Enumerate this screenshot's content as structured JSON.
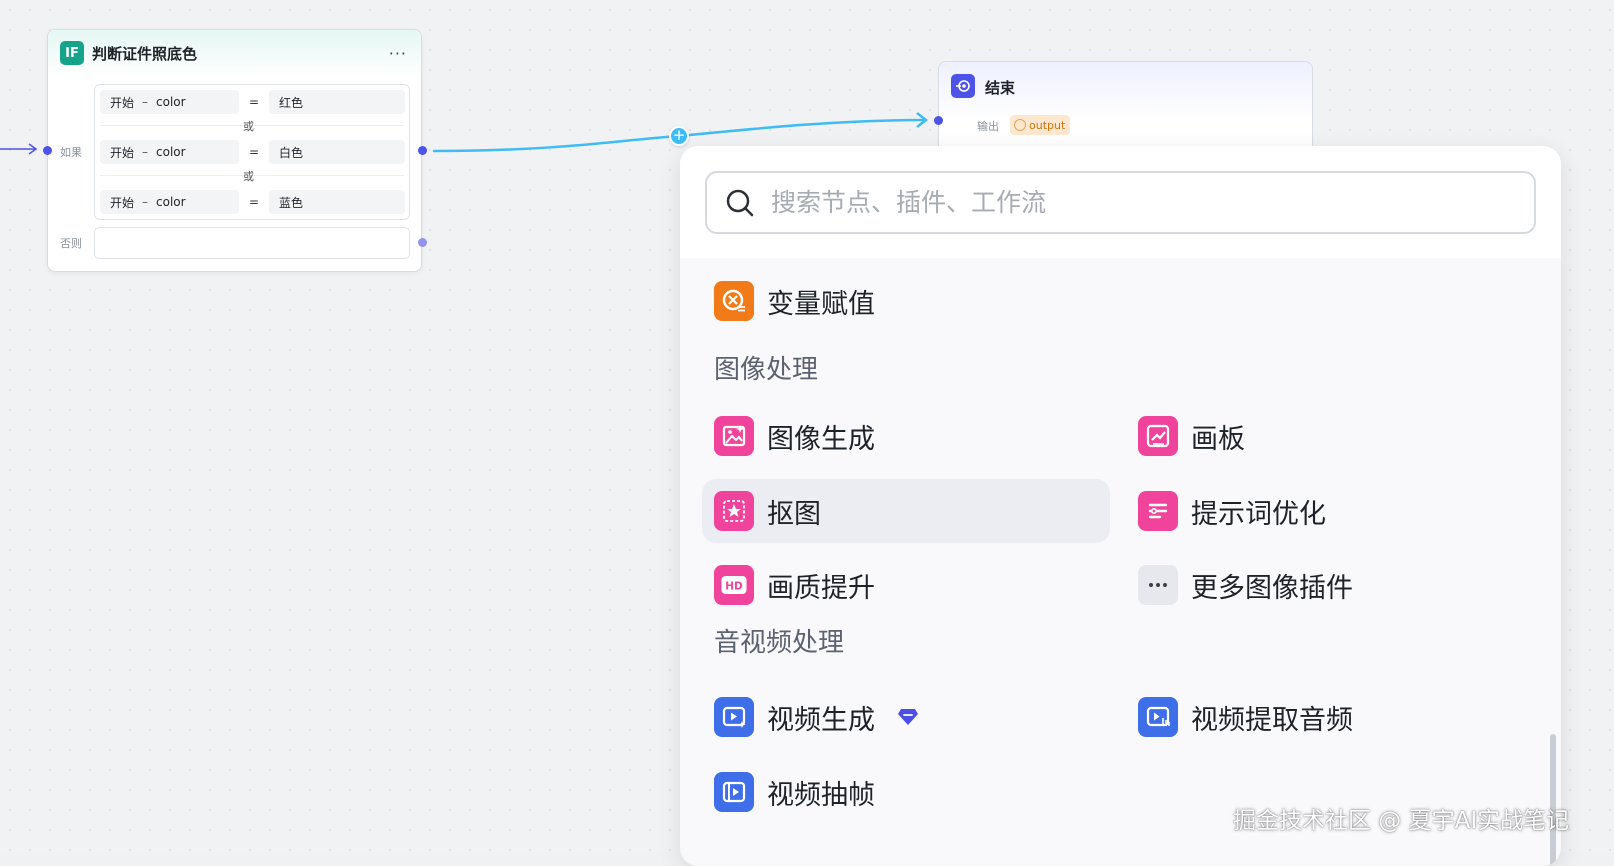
{
  "if_node": {
    "icon_text": "IF",
    "title": "判断证件照底色",
    "more": "···",
    "if_label": "如果",
    "else_label": "否则",
    "or_label": "或",
    "conditions": [
      {
        "source": "开始",
        "dash": "–",
        "field": "color",
        "op": "=",
        "value": "红色"
      },
      {
        "source": "开始",
        "dash": "–",
        "field": "color",
        "op": "=",
        "value": "白色"
      },
      {
        "source": "开始",
        "dash": "–",
        "field": "color",
        "op": "=",
        "value": "蓝色"
      }
    ]
  },
  "end_node": {
    "title": "结束",
    "output_label": "输出",
    "output_var": "output"
  },
  "add_button": "+",
  "picker": {
    "search_placeholder": "搜索节点、插件、工作流",
    "top_item": {
      "label": "变量赋值",
      "icon": "variable-assign-icon",
      "color": "#f07b18"
    },
    "sections": [
      {
        "title": "图像处理",
        "items": [
          {
            "label": "图像生成",
            "icon": "image-generate-icon",
            "color": "#f0449c"
          },
          {
            "label": "画板",
            "icon": "canvas-board-icon",
            "color": "#f0449c"
          },
          {
            "label": "抠图",
            "icon": "cutout-icon",
            "color": "#f0449c",
            "active": true
          },
          {
            "label": "提示词优化",
            "icon": "prompt-optimize-icon",
            "color": "#f0449c"
          },
          {
            "label": "画质提升",
            "icon": "hd-enhance-icon",
            "color": "#f0449c"
          },
          {
            "label": "更多图像插件",
            "icon": "more-icon",
            "color": "#e6e8ee"
          }
        ]
      },
      {
        "title": "音视频处理",
        "items": [
          {
            "label": "视频生成",
            "icon": "video-generate-icon",
            "color": "#3f6fe8",
            "badge": "diamond-icon"
          },
          {
            "label": "视频提取音频",
            "icon": "video-extract-audio-icon",
            "color": "#3f6fe8"
          },
          {
            "label": "视频抽帧",
            "icon": "video-frame-icon",
            "color": "#3f6fe8"
          }
        ]
      }
    ]
  },
  "colors": {
    "edge": "#3fbcf4",
    "port": "#4d53e8",
    "image_icon": "#f0449c",
    "video_icon": "#3f6fe8",
    "variable_icon": "#f07b18"
  },
  "watermark": "掘金技术社区 @ 夏宇AI实战笔记"
}
